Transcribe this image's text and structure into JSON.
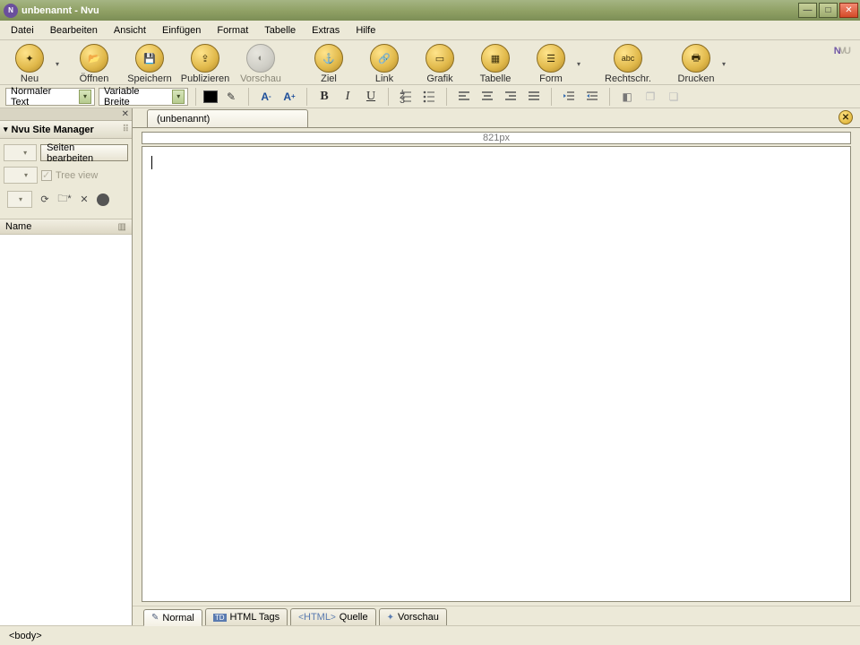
{
  "titlebar": {
    "title": "unbenannt - Nvu"
  },
  "menu": {
    "items": [
      "Datei",
      "Bearbeiten",
      "Ansicht",
      "Einfügen",
      "Format",
      "Tabelle",
      "Extras",
      "Hilfe"
    ]
  },
  "toolbar": {
    "neu": "Neu",
    "oeffnen": "Öffnen",
    "speichern": "Speichern",
    "publizieren": "Publizieren",
    "vorschau": "Vorschau",
    "ziel": "Ziel",
    "link": "Link",
    "grafik": "Grafik",
    "tabelle": "Tabelle",
    "form": "Form",
    "rechtschr": "Rechtschr.",
    "drucken": "Drucken"
  },
  "format": {
    "para_style": "Normaler Text",
    "font_width": "Variable Breite"
  },
  "sidebar": {
    "title": "Nvu Site Manager",
    "edit_pages": "Seiten bearbeiten",
    "tree_view": "Tree view",
    "name_header": "Name"
  },
  "doc": {
    "tab_title": "(unbenannt)",
    "ruler_label": "821px"
  },
  "viewtabs": {
    "normal": "Normal",
    "htmltags": "HTML Tags",
    "quelle": "Quelle",
    "html_prefix": "HTML",
    "vorschau": "Vorschau"
  },
  "status": {
    "path": "<body>"
  }
}
